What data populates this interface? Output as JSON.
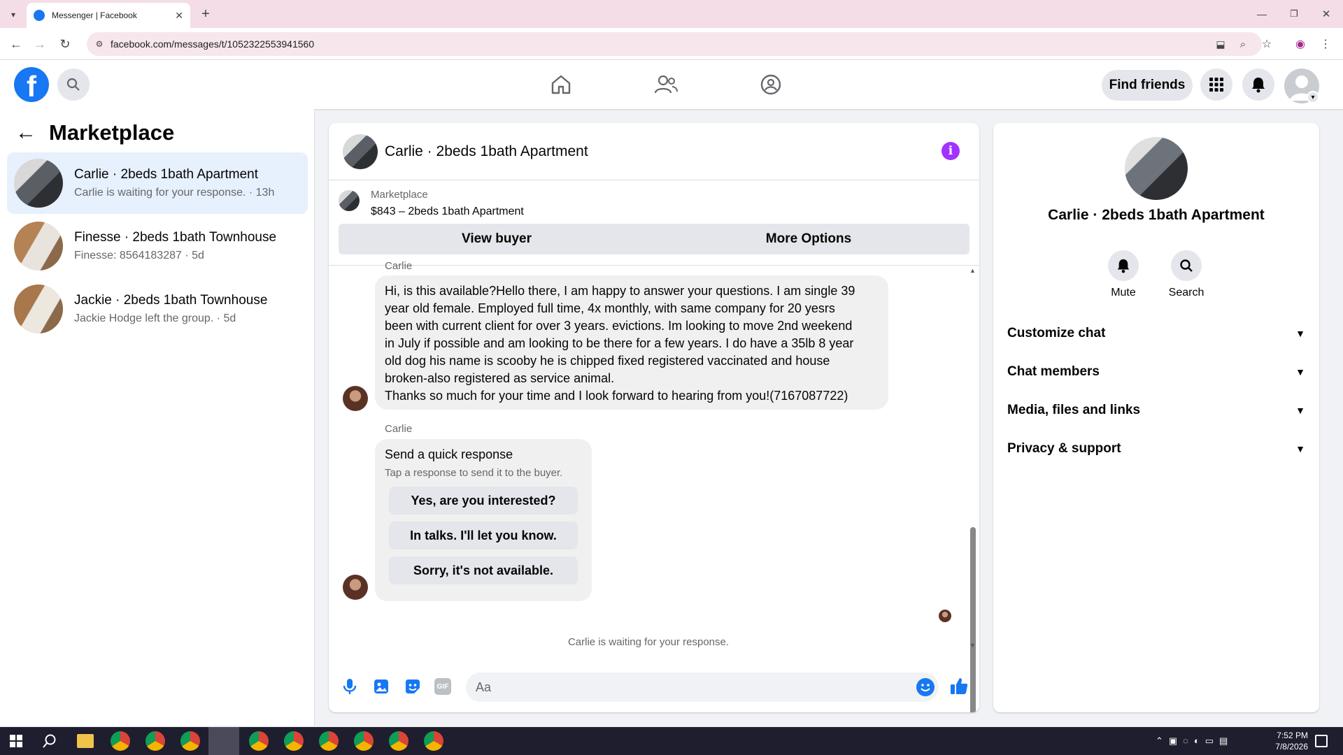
{
  "browser": {
    "tab_title": "Messenger | Facebook",
    "url": "facebook.com/messages/t/1052322553941560"
  },
  "header": {
    "find_friends": "Find friends"
  },
  "left": {
    "title": "Marketplace",
    "conversations": [
      {
        "title": "Carlie · 2beds 1bath Apartment",
        "subtitle": "Carlie is waiting for your response. · 13h"
      },
      {
        "title": "Finesse · 2beds 1bath Townhouse",
        "subtitle": "Finesse: 8564183287 · 5d"
      },
      {
        "title": "Jackie · 2beds 1bath Townhouse",
        "subtitle": "Jackie Hodge left the group. · 5d"
      }
    ]
  },
  "chat": {
    "title": "Carlie · 2beds 1bath Apartment",
    "listing_label": "Marketplace",
    "listing_price": "$843 – 2beds 1bath Apartment",
    "view_buyer": "View buyer",
    "more_options": "More Options",
    "sender_top": "Carlie",
    "message_lines": [
      "Hi, is this available?Hello there, I am happy to answer your questions.  I am single 39",
      "year old female. Employed full time, 4x  monthly, with same company for 20 yesrs",
      "been with current client for over 3 years. evictions. Im looking to move 2nd weekend",
      "in July if possible and am looking to be there for a few years. I do have a 35lb  8 year",
      "old dog his name is scooby he is chipped fixed registered vaccinated and house",
      "broken-also registered as service animal.",
      "Thanks so much for your time and I look forward to hearing from you!(7167087722)"
    ],
    "sender2": "Carlie",
    "quick_title": "Send a quick response",
    "quick_sub": "Tap a response to send it to the buyer.",
    "quick_options": [
      "Yes, are you interested?",
      "In talks. I'll let you know.",
      "Sorry, it's not available."
    ],
    "waiting": "Carlie is waiting for your response.",
    "input_placeholder": "Aa"
  },
  "right": {
    "name": "Carlie · 2beds 1bath Apartment",
    "mute": "Mute",
    "search": "Search",
    "sections": [
      "Customize chat",
      "Chat members",
      "Media, files and links",
      "Privacy & support"
    ]
  },
  "taskbar": {
    "time": "7:52 PM",
    "date": "7/8/2026"
  },
  "colors": {
    "accent": "#1877f2",
    "info": "#a033ff",
    "tabbar": "#f4dde6"
  }
}
